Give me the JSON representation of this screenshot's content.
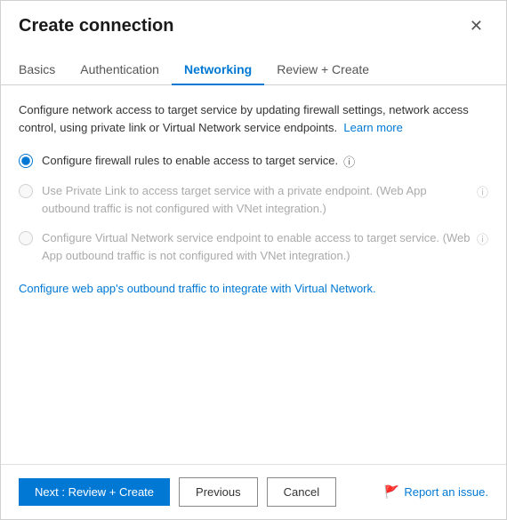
{
  "dialog": {
    "title": "Create connection",
    "close_label": "✕"
  },
  "tabs": [
    {
      "id": "basics",
      "label": "Basics",
      "active": false
    },
    {
      "id": "authentication",
      "label": "Authentication",
      "active": false
    },
    {
      "id": "networking",
      "label": "Networking",
      "active": true
    },
    {
      "id": "review-create",
      "label": "Review + Create",
      "active": false
    }
  ],
  "body": {
    "description": "Configure network access to target service by updating firewall settings, network access control, using private link or Virtual Network service endpoints.",
    "learn_more_label": "Learn more",
    "radio_options": [
      {
        "id": "firewall",
        "label": "Configure firewall rules to enable access to target service.",
        "disabled": false,
        "checked": true
      },
      {
        "id": "private-link",
        "label": "Use Private Link to access target service with a private endpoint. (Web App outbound traffic is not configured with VNet integration.)",
        "disabled": true,
        "checked": false
      },
      {
        "id": "vnet-endpoint",
        "label": "Configure Virtual Network service endpoint to enable access to target service. (Web App outbound traffic is not configured with VNet integration.)",
        "disabled": true,
        "checked": false
      }
    ],
    "vnet_link_text": "Configure web app's outbound traffic to integrate with Virtual Network."
  },
  "footer": {
    "next_label": "Next : Review + Create",
    "previous_label": "Previous",
    "cancel_label": "Cancel",
    "report_label": "Report an issue."
  }
}
